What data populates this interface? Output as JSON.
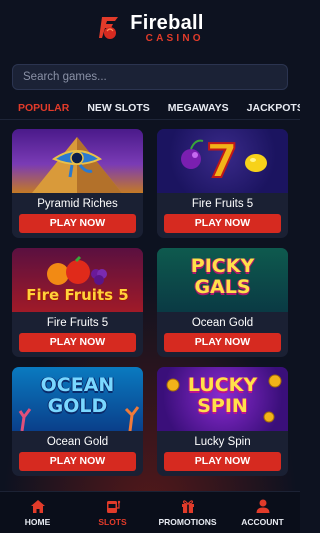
{
  "brand": {
    "name": "Fireball",
    "sub": "CASINO",
    "accent": "#e23b2a",
    "background": "#0d1220"
  },
  "search": {
    "placeholder": "Search games..."
  },
  "tabs": [
    {
      "label": "POPULAR",
      "active": true
    },
    {
      "label": "NEW SLOTS"
    },
    {
      "label": "MEGAWAYS"
    },
    {
      "label": "JACKPOTS"
    }
  ],
  "games": [
    {
      "title": "Pyramid Riches",
      "button": "PLAY NOW",
      "art": "eye-of-horus-pyramid"
    },
    {
      "title": "Fire Fruits 5",
      "button": "PLAY NOW",
      "art": "seven-cherries-lemon"
    },
    {
      "title": "Fire Fruits 5",
      "button": "PLAY NOW",
      "art": "fire-fruits-5-logo",
      "art_text": "Fire Fruits 5"
    },
    {
      "title": "Ocean Gold",
      "button": "PLAY NOW",
      "art": "picky-gals-logo",
      "art_text": "PICKY GALS"
    },
    {
      "title": "Ocean Gold",
      "button": "PLAY NOW",
      "art": "ocean-gold-logo",
      "art_text": "OCEAN GOLD"
    },
    {
      "title": "Lucky Spin",
      "button": "PLAY NOW",
      "art": "lucky-spin-logo",
      "art_text": "LUCKY SPIN"
    }
  ],
  "nav": [
    {
      "label": "HOME",
      "icon": "home-icon"
    },
    {
      "label": "SLOTS",
      "icon": "slot-machine-icon",
      "active": true
    },
    {
      "label": "PROMOTIONS",
      "icon": "gift-icon"
    },
    {
      "label": "ACCOUNT",
      "icon": "user-icon"
    }
  ]
}
